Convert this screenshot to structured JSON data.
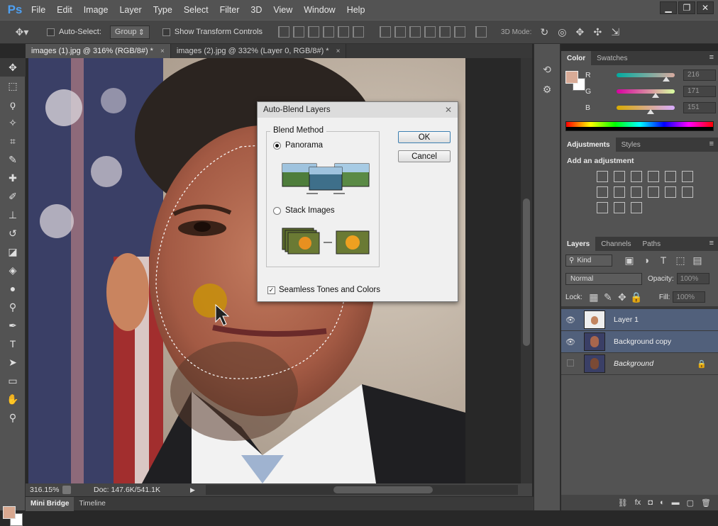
{
  "app": {
    "logo_text": "Ps"
  },
  "menu": [
    "File",
    "Edit",
    "Image",
    "Layer",
    "Type",
    "Select",
    "Filter",
    "3D",
    "View",
    "Window",
    "Help"
  ],
  "window_controls": {
    "minimize": "▁",
    "restore": "❐",
    "close": "✕"
  },
  "options_bar": {
    "auto_select_label": "Auto-Select:",
    "auto_select_value": "Group",
    "show_transform_label": "Show Transform Controls",
    "mode_label": "3D Mode:"
  },
  "tabs": [
    {
      "label": "images (1).jpg @ 316% (RGB/8#) *",
      "close": "×"
    },
    {
      "label": "images (2).jpg @ 332% (Layer 0, RGB/8#) *",
      "close": "×"
    }
  ],
  "status": {
    "zoom": "316.15%",
    "doc": "Doc: 147.6K/541.1K"
  },
  "bottom_tabs": [
    "Mini Bridge",
    "Timeline"
  ],
  "color_panel": {
    "tabs": [
      "Color",
      "Swatches"
    ],
    "channels": [
      {
        "label": "R",
        "value": "216",
        "fraction": 0.85
      },
      {
        "label": "G",
        "value": "171",
        "fraction": 0.67
      },
      {
        "label": "B",
        "value": "151",
        "fraction": 0.59
      }
    ],
    "foreground": "#d8ab97"
  },
  "adjustments_panel": {
    "tabs": [
      "Adjustments",
      "Styles"
    ],
    "heading": "Add an adjustment"
  },
  "layers_panel": {
    "tabs": [
      "Layers",
      "Channels",
      "Paths"
    ],
    "kind_label": "Kind",
    "blend_mode": "Normal",
    "opacity_label": "Opacity:",
    "opacity_value": "100%",
    "lock_label": "Lock:",
    "fill_label": "Fill:",
    "fill_value": "100%",
    "layers": [
      {
        "name": "Layer 1",
        "visible": true,
        "selected": true
      },
      {
        "name": "Background copy",
        "visible": true,
        "selected": true
      },
      {
        "name": "Background",
        "visible": false,
        "selected": false,
        "locked": true
      }
    ]
  },
  "dialog": {
    "title": "Auto-Blend Layers",
    "group_label": "Blend Method",
    "options": [
      {
        "label": "Panorama",
        "selected": true
      },
      {
        "label": "Stack Images",
        "selected": false
      }
    ],
    "seamless_label": "Seamless Tones and Colors",
    "seamless_checked": true,
    "ok_label": "OK",
    "cancel_label": "Cancel",
    "close_glyph": "✕"
  },
  "icons": {
    "move_tool": "move-tool-icon",
    "marquee_tool": "marquee-tool-icon",
    "lasso_tool": "lasso-tool-icon",
    "magic_wand_tool": "magic-wand-icon",
    "crop_tool": "crop-tool-icon",
    "eyedropper_tool": "eyedropper-icon",
    "healing_tool": "healing-brush-icon",
    "brush_tool": "brush-tool-icon",
    "stamp_tool": "clone-stamp-icon",
    "history_brush_tool": "history-brush-icon",
    "eraser_tool": "eraser-icon",
    "bucket_tool": "paint-bucket-icon",
    "blur_tool": "blur-tool-icon",
    "dodge_tool": "dodge-tool-icon",
    "pen_tool": "pen-tool-icon",
    "type_tool": "type-tool-icon",
    "path_select_tool": "path-selection-icon",
    "shape_tool": "rectangle-tool-icon",
    "hand_tool": "hand-tool-icon",
    "zoom_tool": "zoom-tool-icon"
  }
}
